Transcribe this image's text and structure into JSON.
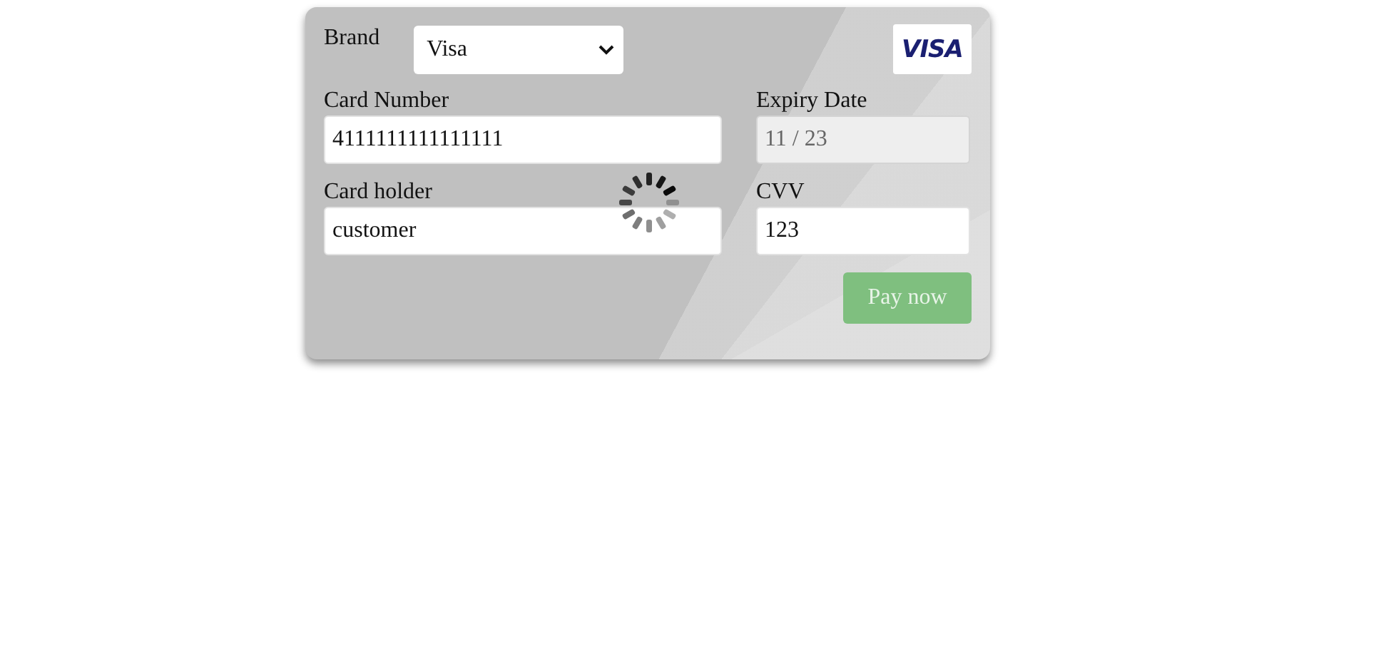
{
  "brand": {
    "label": "Brand",
    "value": "Visa"
  },
  "logo": "VISA",
  "fields": [
    {
      "label": "Card Number",
      "value": "4111111111111111",
      "disabled": false
    },
    {
      "label": "Expiry Date",
      "value": "11 / 23",
      "disabled": true
    },
    {
      "label": "Card holder",
      "value": "customer",
      "disabled": false
    },
    {
      "label": "CVV",
      "value": "123",
      "disabled": false
    }
  ],
  "pay_button": {
    "label": "Pay now",
    "disabled": true
  },
  "loading": true
}
